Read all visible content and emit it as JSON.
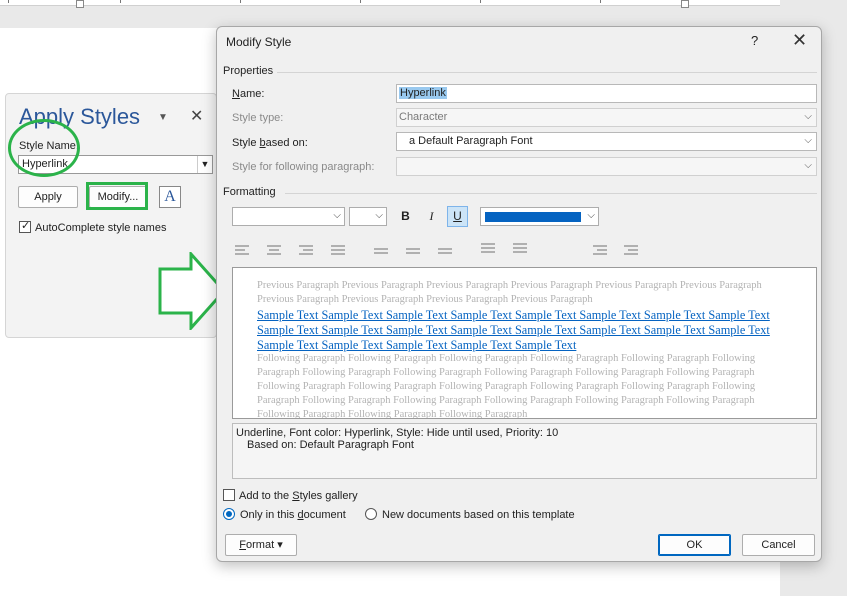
{
  "apply_styles": {
    "title": "Apply Styles",
    "style_name_label": "Style Name:",
    "style_name_value": "Hyperlink",
    "apply_label": "Apply",
    "modify_label": "Modify...",
    "style_inspector_glyph": "A",
    "autocomplete_label": "AutoComplete style names",
    "autocomplete_checked": true
  },
  "dialog": {
    "title": "Modify Style",
    "help": "?",
    "close": "✕",
    "properties_heading": "Properties",
    "name_label": "Name:",
    "name_value": "Hyperlink",
    "style_type_label": "Style type:",
    "style_type_value": "Character",
    "based_on_label": "Style based on:",
    "based_on_value": "a  Default Paragraph Font",
    "following_label": "Style for following paragraph:",
    "following_value": "",
    "formatting_heading": "Formatting",
    "bold": "B",
    "italic": "I",
    "underline": "U",
    "font_color": "#0563c1",
    "preview": {
      "previous": "Previous Paragraph Previous Paragraph Previous Paragraph Previous Paragraph Previous Paragraph Previous Paragraph Previous Paragraph Previous Paragraph Previous Paragraph Previous Paragraph",
      "sample": "Sample Text Sample Text Sample Text Sample Text Sample Text Sample Text Sample Text Sample Text Sample Text Sample Text Sample Text Sample Text Sample Text Sample Text Sample Text Sample Text Sample Text Sample Text Sample Text Sample Text Sample Text",
      "following": "Following Paragraph Following Paragraph Following Paragraph Following Paragraph Following Paragraph Following Paragraph Following Paragraph Following Paragraph Following Paragraph Following Paragraph Following Paragraph Following Paragraph Following Paragraph Following Paragraph Following Paragraph Following Paragraph Following Paragraph Following Paragraph Following Paragraph Following Paragraph Following Paragraph Following Paragraph Following Paragraph Following Paragraph Following Paragraph"
    },
    "description_line1": "Underline, Font color: Hyperlink, Style: Hide until used, Priority: 10",
    "description_line2": "Based on: Default Paragraph Font",
    "add_to_gallery_label": "Add to the Styles gallery",
    "add_to_gallery_checked": false,
    "only_this_document_label": "Only in this document",
    "new_documents_label": "New documents based on this template",
    "format_label": "Format ▾",
    "ok_label": "OK",
    "cancel_label": "Cancel"
  },
  "colors": {
    "highlight_green": "#2bb34a",
    "accent_blue": "#0067c0",
    "hyperlink_blue": "#0563c1",
    "pane_title_blue": "#2b579a"
  }
}
